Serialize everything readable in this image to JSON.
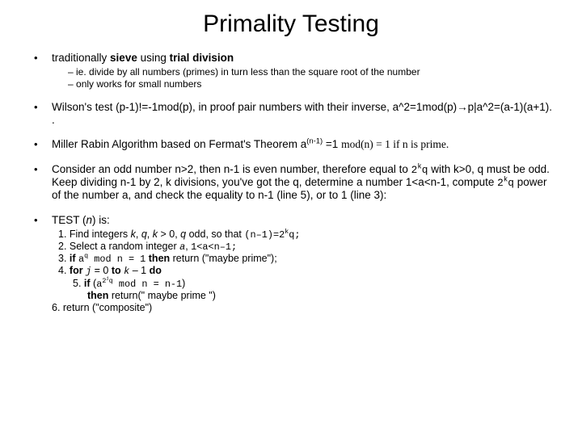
{
  "title": "Primality Testing",
  "bullets": {
    "b1_pre": "traditionally ",
    "b1_sieve": "sieve",
    "b1_mid": " using ",
    "b1_trial": "trial division",
    "b1_sub1": "ie. divide by all numbers (primes) in turn less than the square root of the number",
    "b1_sub2": "only works for small numbers",
    "b2": "Wilson's test (p-1)!=-1mod(p), in proof pair numbers with their inverse, a^2=1mod(p)→p|a^2=(a-1)(a+1). .",
    "b3_a": "Miller Rabin Algorithm based on Fermat's Theorem a",
    "b3_sup": "(n-1)",
    "b3_b": " =1 ",
    "b3_serif": "mod(n) = 1 if n is prime.",
    "b4_a": "Consider an odd number n>2, then n-1 is even number, therefore equal to ",
    "b4_m1": "2",
    "b4_m1sup": "k",
    "b4_m1b": "q",
    "b4_b": " with k>0, q must be odd. Keep dividing n-1 by 2, k divisions, you've got the q, determine a number 1<a<n-1, compute ",
    "b4_m2": "2",
    "b4_m2sup": "k",
    "b4_m2b": "q",
    "b4_c": " power of the number a, and check the equality to n-1 (line 5), or to 1 (line 3):",
    "b5_head_a": "TEST (",
    "b5_head_n": "n",
    "b5_head_b": ") is:",
    "s1a": "1. Find integers ",
    "s1_k": "k",
    "s1b": ", ",
    "s1_q": "q",
    "s1c": ", ",
    "s1_k2": "k",
    "s1d": " > 0, ",
    "s1_q2": "q",
    "s1e": " odd, so that ",
    "s1_code_a": "(n–1)=2",
    "s1_code_sup": "k",
    "s1_code_b": "q;",
    "s2a": "2. Select a random integer ",
    "s2_a": "a",
    "s2b": ", ",
    "s2_code": "1<a<n–1;",
    "s3a": "3. ",
    "s3_if": "if ",
    "s3_code_a": "a",
    "s3_code_sup": "q",
    "s3_code_b": " mod n = 1",
    "s3_then": " then ",
    "s3_ret": "return (\"maybe prime\");",
    "s4a": "4. ",
    "s4_for": "for ",
    "s4_j": "j",
    "s4b": " = 0 ",
    "s4_to": "to ",
    "s4_k": "k",
    "s4c": " – 1 ",
    "s4_do": "do",
    "s5a": "5. ",
    "s5_if": "if ",
    "s5_p": "(",
    "s5_code_a": "a",
    "s5_code_sup1": "2",
    "s5_code_sup2": "j",
    "s5_code_sup3": "q",
    "s5_code_b": " mod n = n-1",
    "s5_pc": ")",
    "s5_then": "then ",
    "s5_ret": "return(\" maybe prime \")",
    "s6a": "6. return (\"composite\")"
  }
}
